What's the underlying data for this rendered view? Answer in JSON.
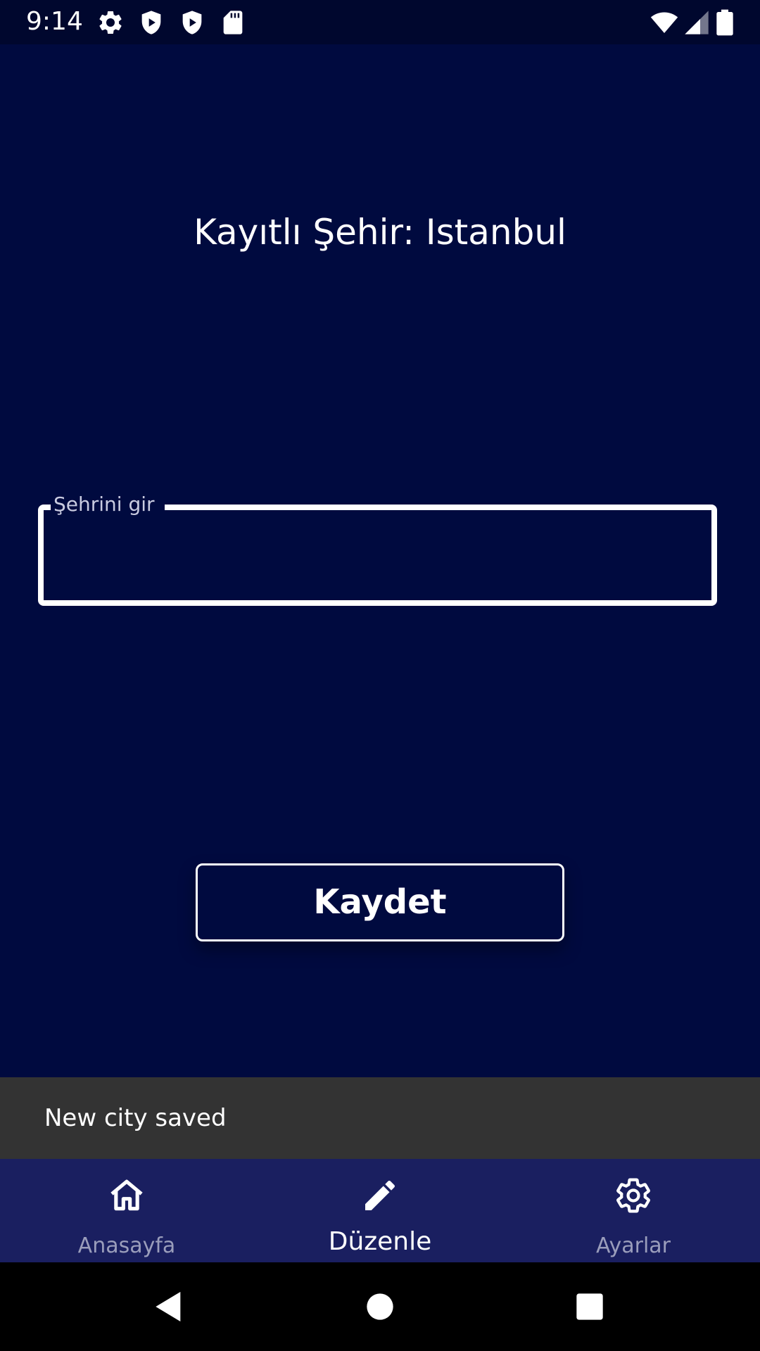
{
  "status_bar": {
    "time": "9:14",
    "icons": [
      "gear-icon",
      "shield-play-icon",
      "shield-play-icon",
      "sd-card-icon",
      "wifi-icon",
      "signal-icon",
      "battery-icon"
    ]
  },
  "main": {
    "saved_city_text": "Kayıtlı Şehir: Istanbul",
    "city_field": {
      "label": "Şehrini gir",
      "value": ""
    },
    "save_button_label": "Kaydet"
  },
  "snackbar": {
    "message": "New city saved"
  },
  "bottom_nav": {
    "items": [
      {
        "label": "Anasayfa",
        "icon": "home-icon",
        "active": false
      },
      {
        "label": "Düzenle",
        "icon": "edit-pencil-icon",
        "active": true
      },
      {
        "label": "Ayarlar",
        "icon": "settings-gear-icon",
        "active": false
      }
    ]
  },
  "system_nav": {
    "buttons": [
      "back-icon",
      "home-circle-icon",
      "recents-square-icon"
    ]
  },
  "colors": {
    "background": "#000a3f",
    "status_bar": "#00072e",
    "bottom_nav": "#1a1f60",
    "snackbar": "#333333",
    "text": "#ffffff",
    "inactive_nav": "#9a9dbb"
  }
}
